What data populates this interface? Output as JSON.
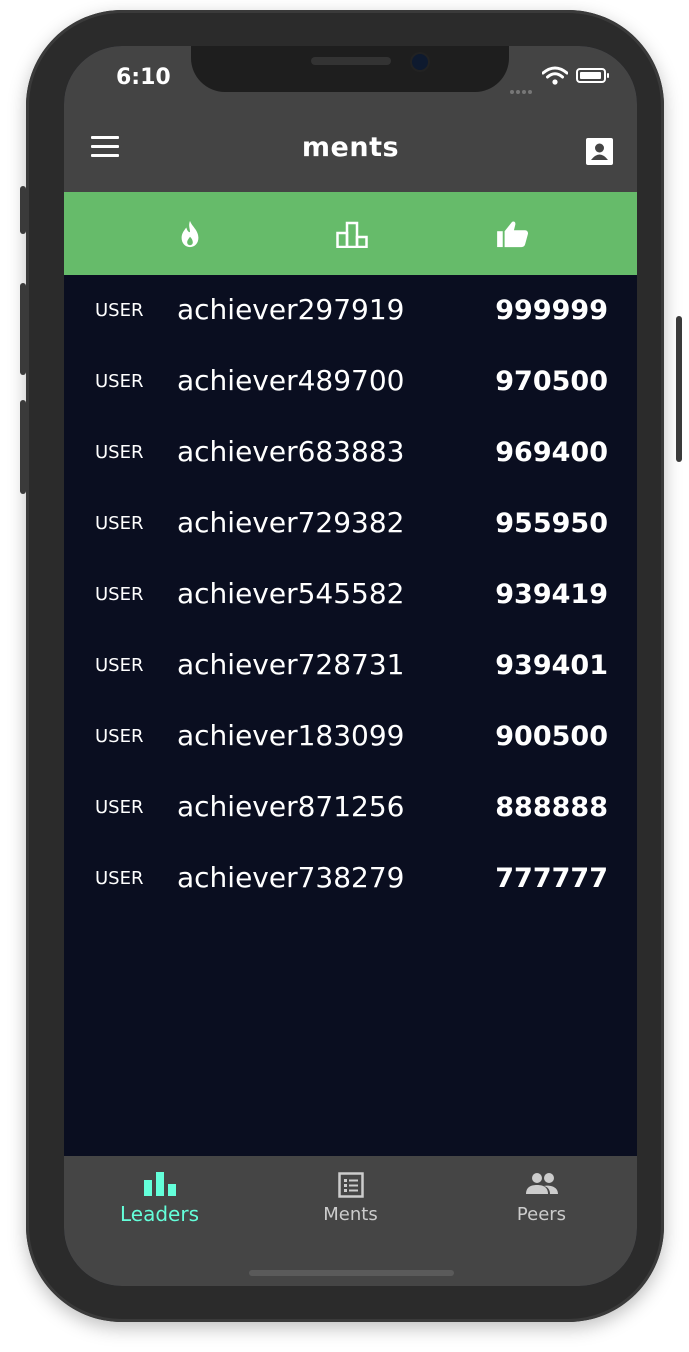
{
  "status_bar": {
    "time": "6:10"
  },
  "header": {
    "title": "ments"
  },
  "filters": [
    {
      "icon": "flame-icon"
    },
    {
      "icon": "podium-icon"
    },
    {
      "icon": "thumbs-up-icon"
    }
  ],
  "leaderboard": [
    {
      "tag": "USER",
      "name": "achiever297919",
      "score": "999999"
    },
    {
      "tag": "USER",
      "name": "achiever489700",
      "score": "970500"
    },
    {
      "tag": "USER",
      "name": "achiever683883",
      "score": "969400"
    },
    {
      "tag": "USER",
      "name": "achiever729382",
      "score": "955950"
    },
    {
      "tag": "USER",
      "name": "achiever545582",
      "score": "939419"
    },
    {
      "tag": "USER",
      "name": "achiever728731",
      "score": "939401"
    },
    {
      "tag": "USER",
      "name": "achiever183099",
      "score": "900500"
    },
    {
      "tag": "USER",
      "name": "achiever871256",
      "score": "888888"
    },
    {
      "tag": "USER",
      "name": "achiever738279",
      "score": "777777"
    }
  ],
  "tabs": [
    {
      "label": "Leaders",
      "icon": "bar-chart-icon",
      "active": true
    },
    {
      "label": "Ments",
      "icon": "list-icon",
      "active": false
    },
    {
      "label": "Peers",
      "icon": "people-icon",
      "active": false
    }
  ],
  "colors": {
    "filter_bar": "#66bb6a",
    "header": "#444444",
    "list_background": "#0a0e20",
    "tab_active": "#64ffda",
    "tab_inactive": "#cccccc"
  }
}
